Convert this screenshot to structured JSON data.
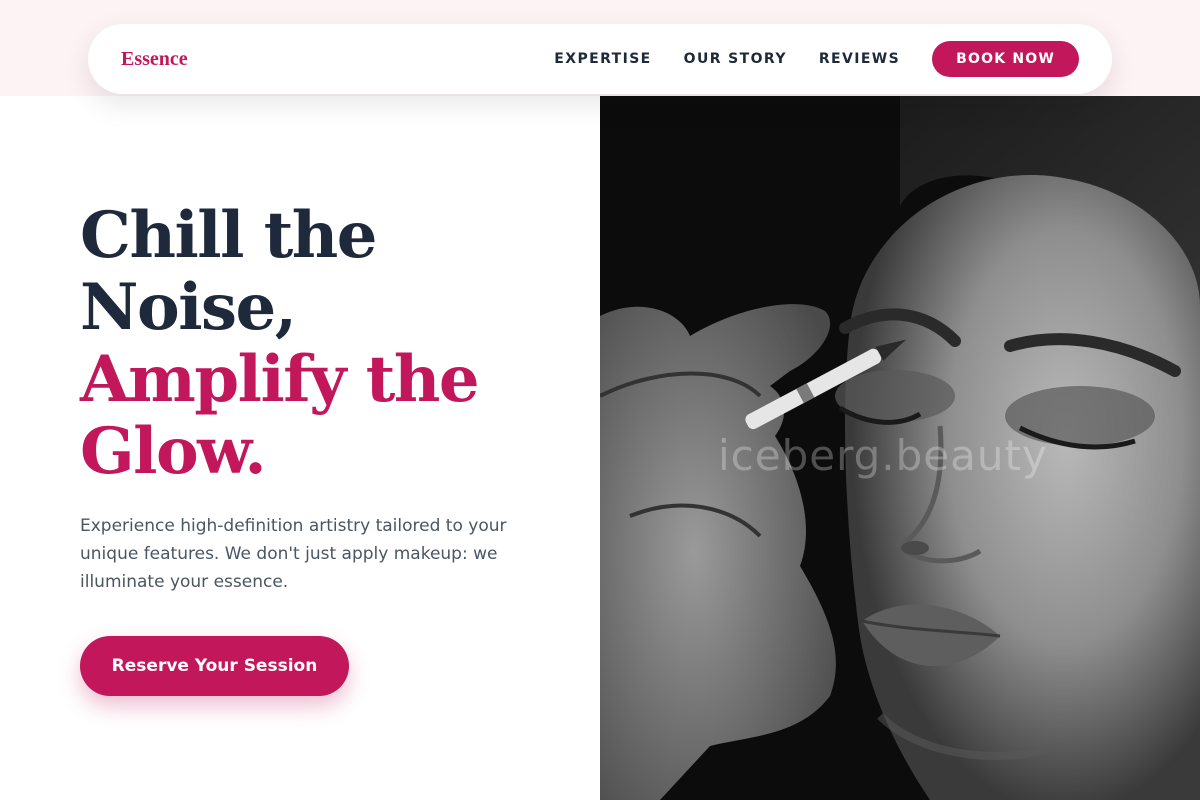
{
  "brand": {
    "name": "Essence",
    "accent_color": "#c2185b"
  },
  "nav": {
    "links": [
      "EXPERTISE",
      "OUR STORY",
      "REVIEWS"
    ],
    "cta_label": "BOOK NOW"
  },
  "hero": {
    "headline_dark": [
      "Chill the",
      "Noise,"
    ],
    "headline_accent": [
      "Amplify the",
      "Glow."
    ],
    "subtext": "Experience high-definition artistry tailored to your unique features. We don't just apply makeup: we illuminate your essence.",
    "cta_label": "Reserve Your Session"
  },
  "image": {
    "description": "black-and-white portrait of a woman having eyebrow makeup applied",
    "watermark": "iceberg.beauty"
  }
}
